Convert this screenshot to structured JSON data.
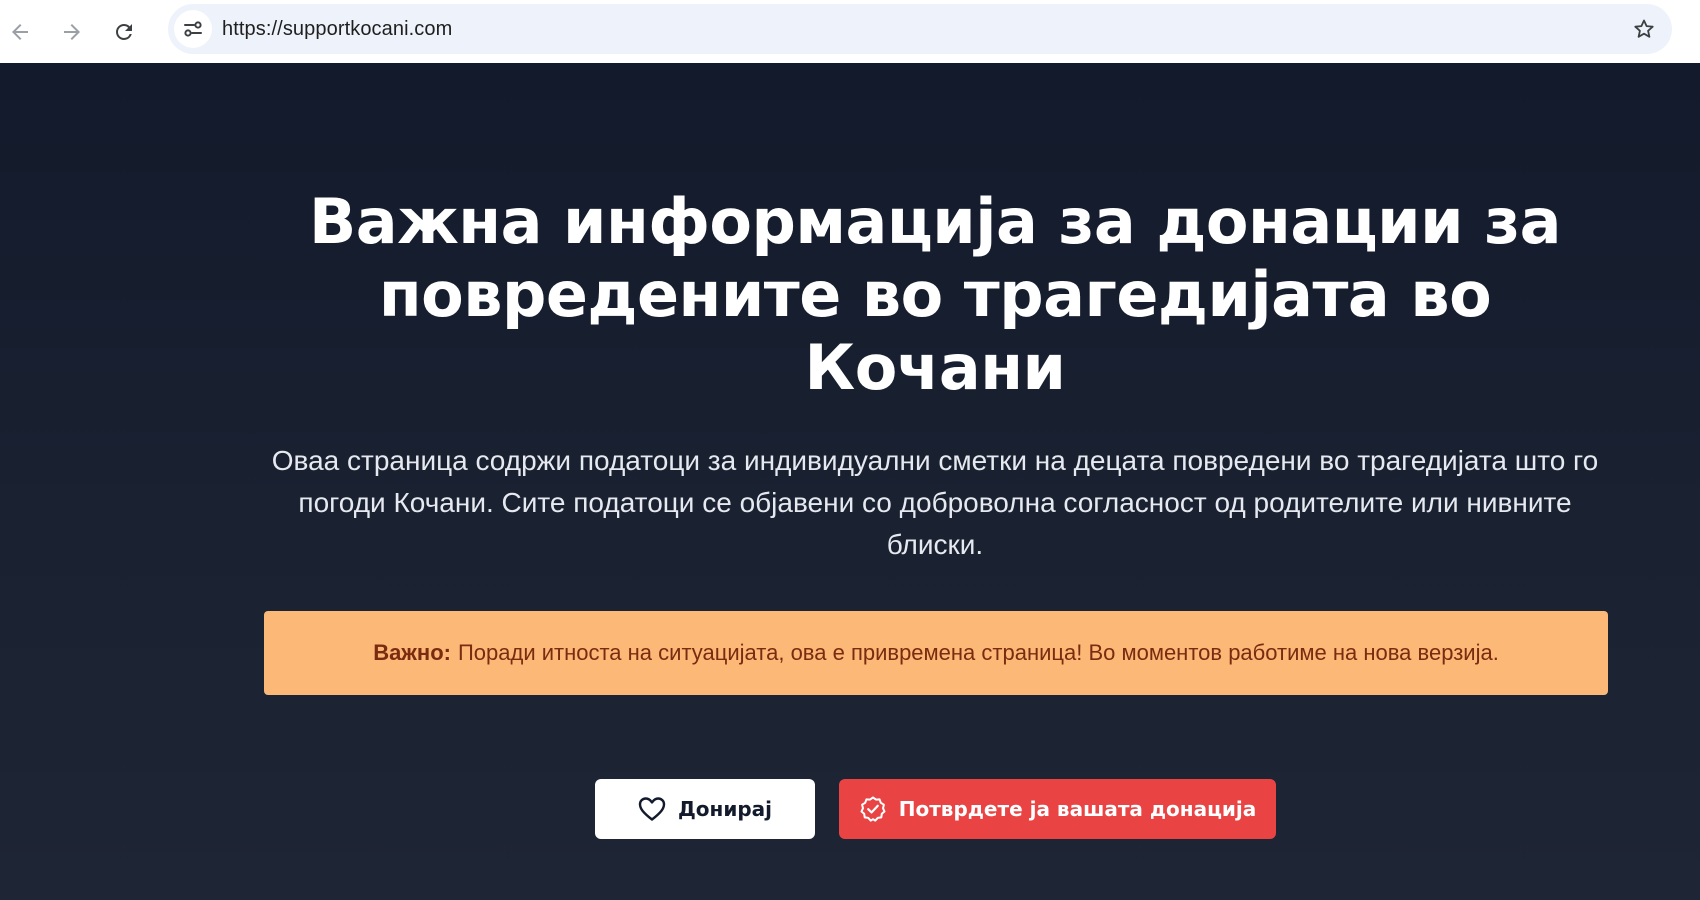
{
  "browser": {
    "url": "https://supportkocani.com"
  },
  "hero": {
    "title": "Важна информација за донации за повредените во трагедијата во Кочани",
    "description": "Оваа страница содржи податоци за индивидуални сметки на децата повредени во трагедијата што го погоди Кочани. Сите податоци се објавени со доброволна согласност од родителите или нивните блиски."
  },
  "notice": {
    "label": "Важно:",
    "text": "Поради итноста на ситуацијата, ова е привремена страница! Во моментов работиме на нова верзија."
  },
  "actions": {
    "donate_label": "Донирај",
    "confirm_label": "Потврдете ја вашата донација"
  },
  "colors": {
    "background": "#161e2e",
    "notice_bg": "#fcb877",
    "notice_text": "#7a2b10",
    "confirm_button": "#ea4343",
    "donate_button": "#ffffff"
  },
  "icons": {
    "back": "arrow-left-icon",
    "forward": "arrow-right-icon",
    "reload": "reload-icon",
    "site_info": "tune-icon",
    "bookmark": "star-icon",
    "donate": "heart-icon",
    "confirm": "check-badge-icon"
  }
}
